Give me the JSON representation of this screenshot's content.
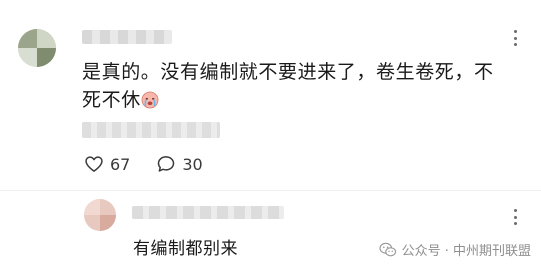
{
  "comment": {
    "text_line1": "是真的。没有编制就不要进来了，卷生卷死，不",
    "text_line2": "死不休",
    "emoji": "crying-face-emoji",
    "like_count": "67",
    "reply_count": "30"
  },
  "reply": {
    "text": "有编制都别来"
  },
  "watermark": {
    "text": "公众号 · 中州期刊联盟"
  },
  "colors": {
    "text": "#1a1a1a",
    "icon": "#3a3a3a",
    "watermark": "#8f8f8f",
    "divider": "#efefef"
  }
}
